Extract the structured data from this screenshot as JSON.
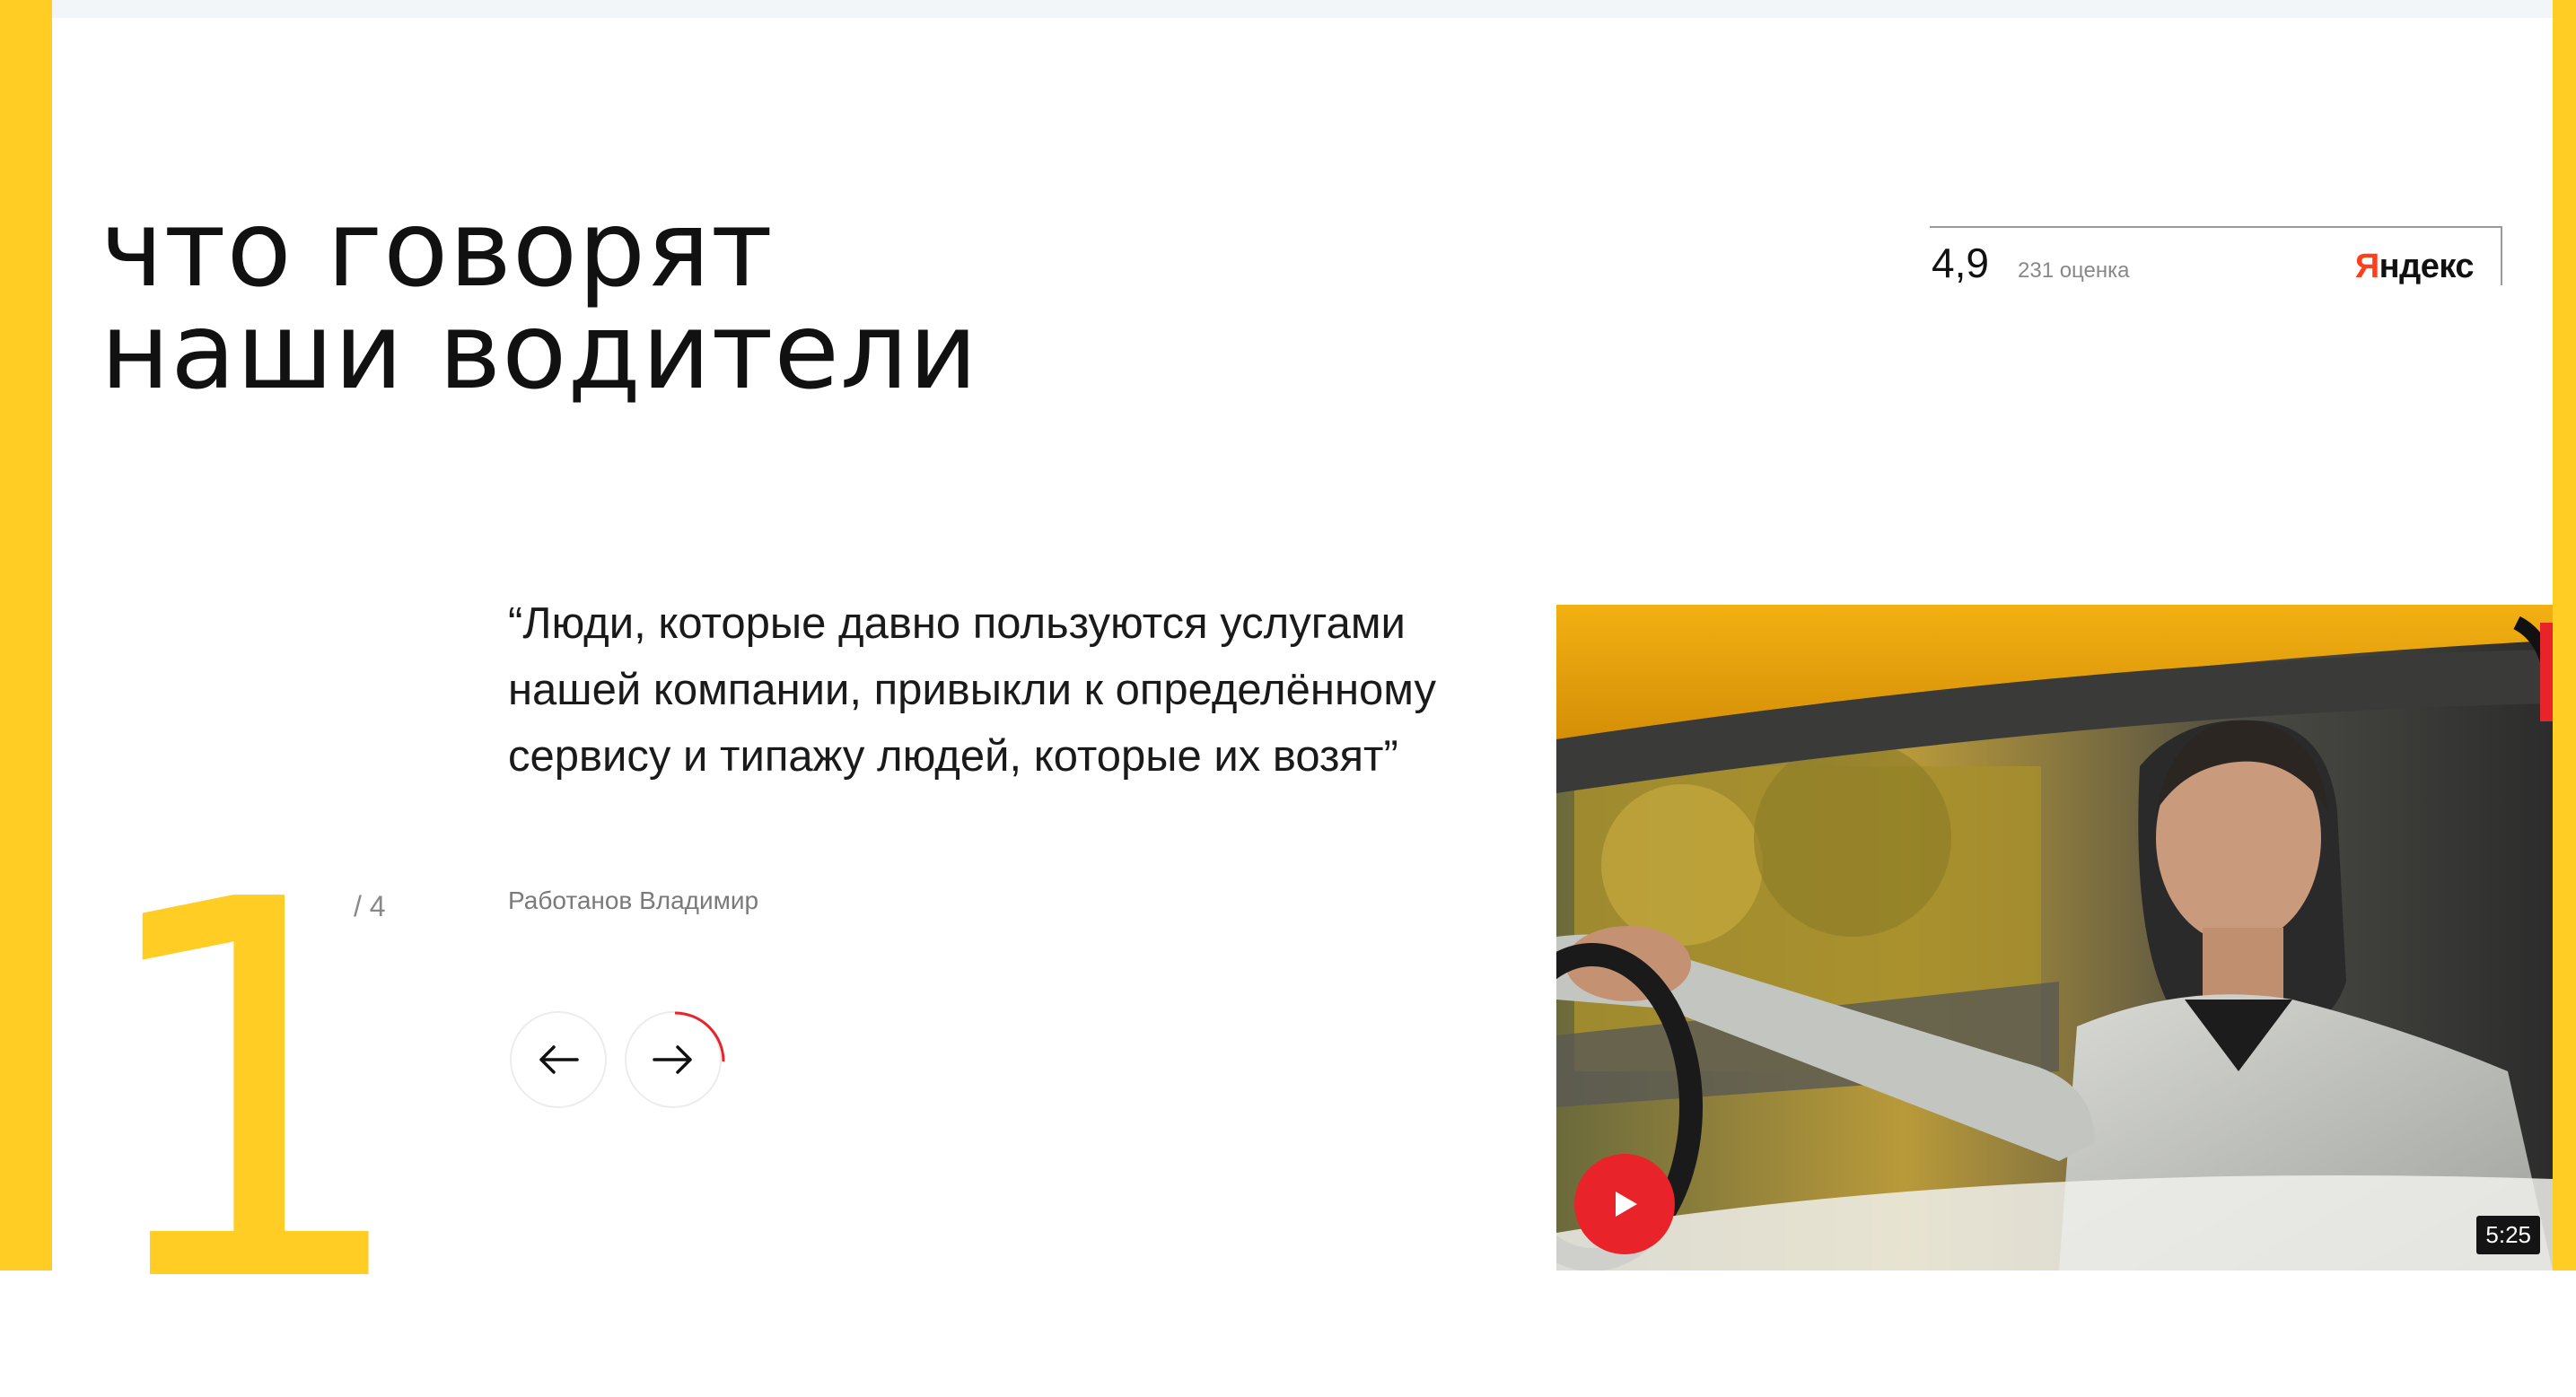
{
  "heading": {
    "line1": "что говорят",
    "line2": "наши водители"
  },
  "rating": {
    "score": "4,9",
    "count": "231 оценка",
    "brand_first": "Я",
    "brand_rest": "ндекс"
  },
  "slider": {
    "current": "1",
    "total": "/ 4",
    "progress": 0.25
  },
  "testimonial": {
    "quote": "“Люди, которые давно пользуются услугами нашей компании, привыкли к определённому сервису и типажу людей, которые их возят”",
    "author": "Работанов Владимир"
  },
  "video": {
    "duration": "5:25",
    "play_icon": "play-icon"
  },
  "colors": {
    "accent_yellow": "#FFCD23",
    "play_red": "#E8232A",
    "brand_red": "#FC3F1D"
  },
  "icons": {
    "prev": "arrow-left-icon",
    "next": "arrow-right-icon"
  }
}
